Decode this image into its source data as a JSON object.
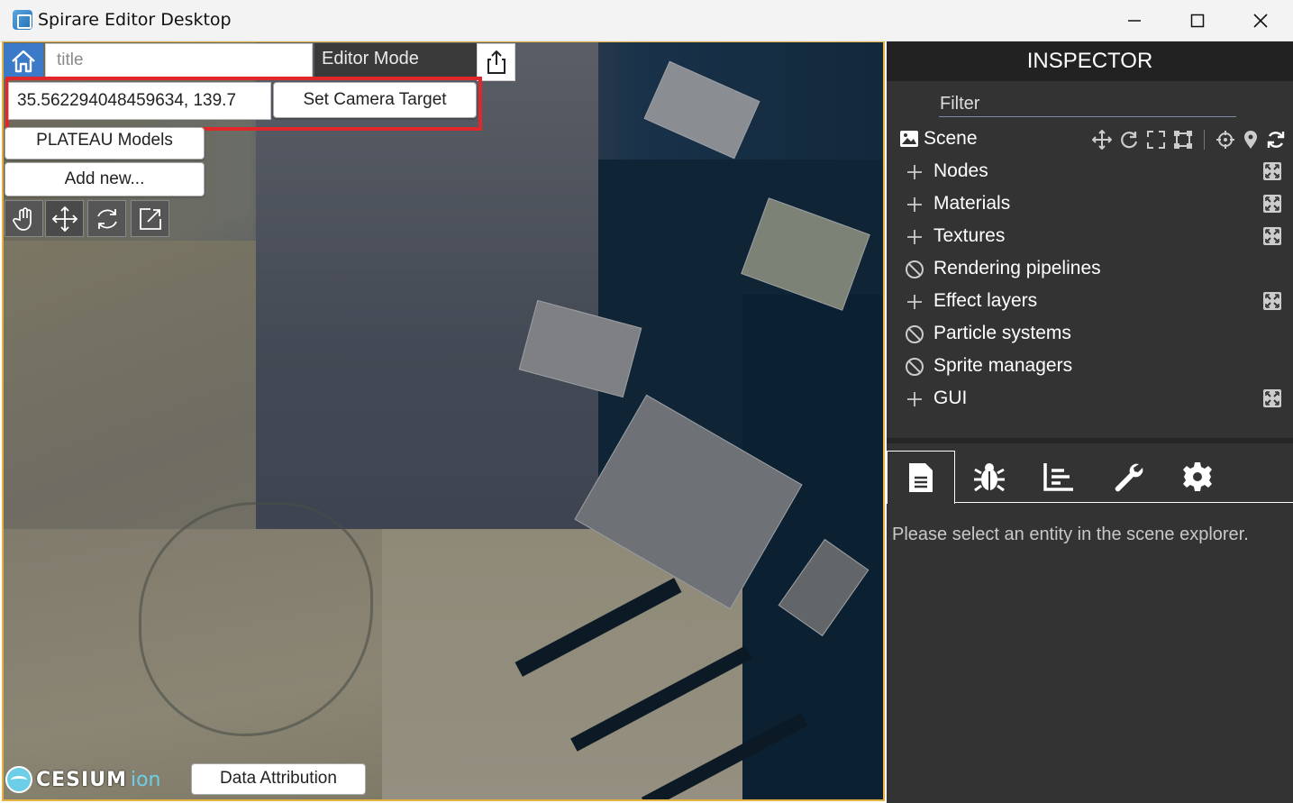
{
  "window": {
    "title": "Spirare Editor Desktop"
  },
  "toolbar": {
    "title_placeholder": "title",
    "mode_label": "Editor Mode",
    "coordinate_value": "35.562294048459634, 139.7",
    "set_camera_target_label": "Set Camera Target",
    "plateau_label": "PLATEAU Models",
    "add_new_label": "Add new..."
  },
  "credits": {
    "cesium_word": "CESIUM",
    "cesium_ion": "ion",
    "attribution_label": "Data Attribution"
  },
  "inspector": {
    "header": "INSPECTOR",
    "filter_placeholder": "Filter",
    "scene_label": "Scene",
    "items": [
      {
        "label": "Nodes",
        "icon": "plus-icon",
        "expandable": true
      },
      {
        "label": "Materials",
        "icon": "plus-icon",
        "expandable": true
      },
      {
        "label": "Textures",
        "icon": "plus-icon",
        "expandable": true
      },
      {
        "label": "Rendering pipelines",
        "icon": "disabled-icon",
        "expandable": false
      },
      {
        "label": "Effect layers",
        "icon": "plus-icon",
        "expandable": true
      },
      {
        "label": "Particle systems",
        "icon": "disabled-icon",
        "expandable": false
      },
      {
        "label": "Sprite managers",
        "icon": "disabled-icon",
        "expandable": false
      },
      {
        "label": "GUI",
        "icon": "plus-icon",
        "expandable": true
      }
    ],
    "tabs": [
      "document-icon",
      "bug-icon",
      "chart-icon",
      "wrench-icon",
      "gear-icon"
    ],
    "empty_message": "Please select an entity in the scene explorer."
  },
  "colors": {
    "highlight": "#e0282b",
    "home_button": "#3b79c9",
    "inspector_bg": "#333333",
    "viewport_border": "#e4b33e"
  }
}
